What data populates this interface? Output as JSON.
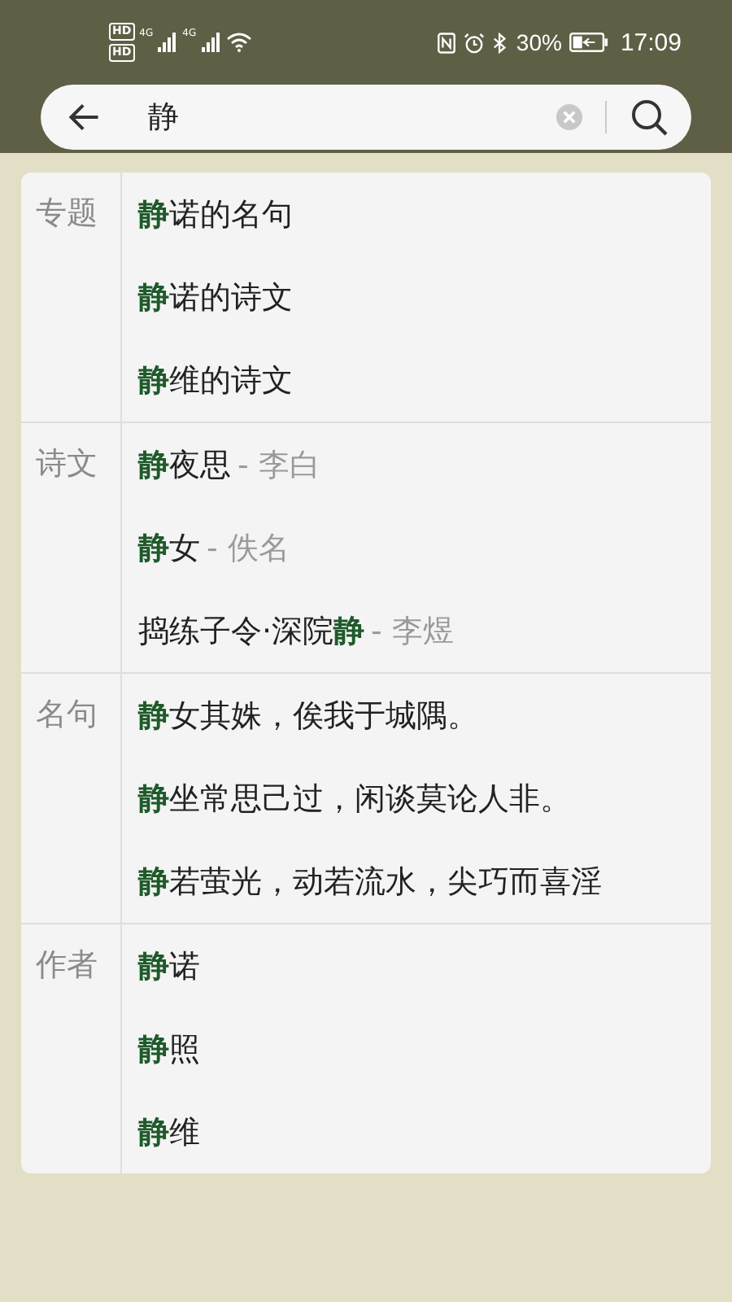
{
  "status_bar": {
    "hd_labels": [
      "HD",
      "HD"
    ],
    "networks": [
      "4G",
      "4G"
    ],
    "battery": "30%",
    "time": "17:09"
  },
  "search": {
    "value": "静"
  },
  "sections": [
    {
      "label": "专题",
      "results": [
        {
          "text": "**静**诺的名句"
        },
        {
          "text": "**静**诺的诗文"
        },
        {
          "text": "**静**维的诗文"
        }
      ]
    },
    {
      "label": "诗文",
      "results": [
        {
          "text": "**静**夜思",
          "author": "- 李白"
        },
        {
          "text": "**静**女",
          "author": "- 佚名"
        },
        {
          "text": "捣练子令·深院**静**",
          "author": "- 李煜"
        }
      ]
    },
    {
      "label": "名句",
      "results": [
        {
          "text": "**静**女其姝，俟我于城隅。"
        },
        {
          "text": "**静**坐常思己过，闲谈莫论人非。"
        },
        {
          "text": "**静**若萤光，动若流水，尖巧而喜淫"
        }
      ]
    },
    {
      "label": "作者",
      "results": [
        {
          "text": "**静**诺"
        },
        {
          "text": "**静**照"
        },
        {
          "text": "**静**维"
        }
      ]
    }
  ]
}
